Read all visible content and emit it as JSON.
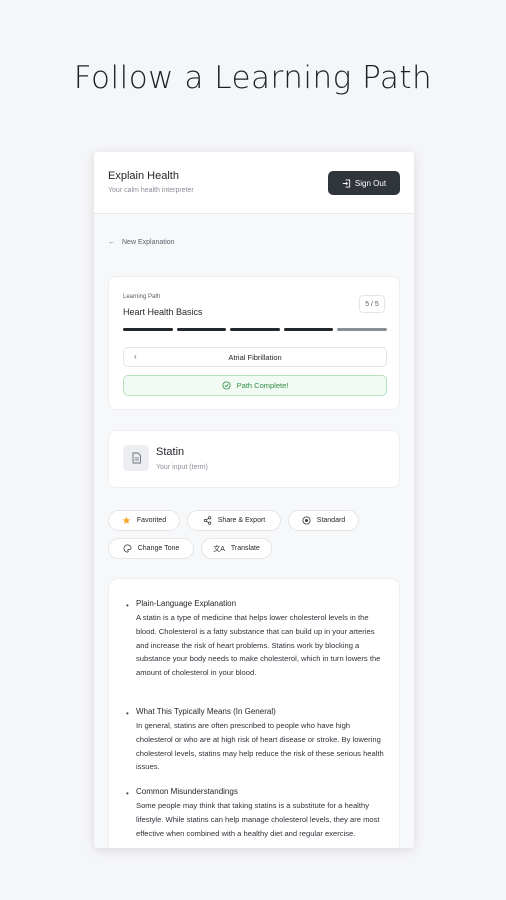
{
  "headline": "Follow a Learning Path",
  "app": {
    "title": "Explain Health",
    "subtitle": "Your calm health interpreter",
    "signout_label": "Sign Out"
  },
  "back_label": "New Explanation",
  "learning_path": {
    "label": "Learning Path",
    "title": "Heart Health Basics",
    "count": "5 / 5",
    "progress": {
      "completed": 5,
      "total": 5
    },
    "current_step": "Atrial Fibrillation",
    "complete_label": "Path Complete!"
  },
  "term": {
    "name": "Statin",
    "sub": "Your input (term)"
  },
  "actions": {
    "favorited": "Favorited",
    "share": "Share & Export",
    "standard": "Standard",
    "tone": "Change Tone",
    "translate": "Translate"
  },
  "explanation": {
    "sections": [
      {
        "heading": "Plain-Language Explanation",
        "body": "A statin is a type of medicine that helps lower cholesterol levels in the blood. Cholesterol is a fatty substance that can build up in your arteries and increase the risk of heart problems. Statins work by blocking a substance your body needs to make cholesterol, which in turn lowers the amount of cholesterol in your blood."
      },
      {
        "heading": "What This Typically Means (In General)",
        "body": "In general, statins are often prescribed to people who have high cholesterol or who are at high risk of heart disease or stroke. By lowering cholesterol levels, statins may help reduce the risk of these serious health issues."
      },
      {
        "heading": "Common Misunderstandings",
        "body": "Some people may think that taking statins is a substitute for a healthy lifestyle. While statins can help manage cholesterol levels, they are most effective when combined with a healthy diet and regular exercise."
      }
    ]
  },
  "colors": {
    "accent_dark": "#30343b",
    "success": "#2f8f45",
    "favorite_star": "#f5a623"
  }
}
